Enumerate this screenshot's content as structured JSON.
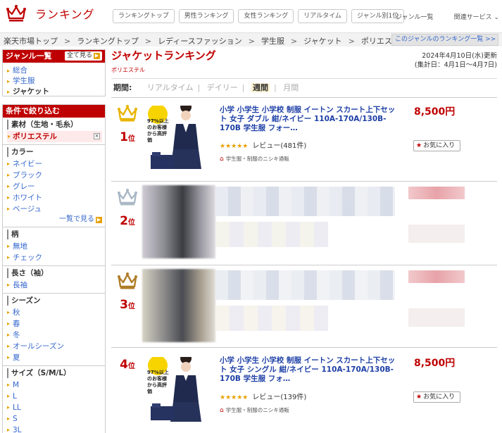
{
  "header": {
    "logo_text": "ランキング",
    "nav": [
      "ランキングトップ",
      "男性ランキング",
      "女性ランキング",
      "リアルタイム",
      "ジャンル別1位"
    ],
    "right_nav": [
      "ジャンル一覧",
      "関連サービス ⌄"
    ]
  },
  "breadcrumb": {
    "items": [
      "楽天市場トップ",
      "ランキングトップ",
      "レディースファッション",
      "学生服",
      "ジャケット",
      "ポリエステル"
    ],
    "separator": ">",
    "genre_ranking_link": "このジャンルのランキング一覧 >>"
  },
  "sidebar": {
    "genre_box": {
      "title": "ジャンル一覧",
      "all_button": "全て見る",
      "items": [
        {
          "label": "総合",
          "current": false
        },
        {
          "label": "学生服",
          "current": false
        },
        {
          "label": "ジャケット",
          "current": true
        }
      ]
    },
    "filter_box": {
      "title": "条件で絞り込む",
      "material": {
        "title": "素材（生地・毛糸）",
        "selected": "ポリエステル",
        "clear": "×"
      },
      "color": {
        "title": "カラー",
        "items": [
          "ネイビー",
          "ブラック",
          "グレー",
          "ホワイト",
          "ベージュ"
        ],
        "more": "一覧で見る"
      },
      "pattern": {
        "title": "柄",
        "items": [
          "無地",
          "チェック"
        ]
      },
      "sleeve": {
        "title": "長さ（袖）",
        "items": [
          "長袖"
        ]
      },
      "season": {
        "title": "シーズン",
        "items": [
          "秋",
          "春",
          "冬",
          "オールシーズン",
          "夏"
        ]
      },
      "size": {
        "title": "サイズ（S/M/L）",
        "items": [
          "M",
          "L",
          "LL",
          "S",
          "3L"
        ]
      }
    }
  },
  "main": {
    "title": "ジャケットランキング",
    "subtitle": "ポリエステル",
    "updated": "2024年4月10日(水)更新",
    "period_range": "(集計日：4月1日～4月7日)",
    "period": {
      "label": "期間:",
      "options": [
        {
          "label": "リアルタイム",
          "active": false
        },
        {
          "label": "デイリー",
          "active": false
        },
        {
          "label": "週間",
          "active": true
        },
        {
          "label": "月間",
          "active": false
        }
      ]
    },
    "items": [
      {
        "rank": "1",
        "rank_suffix": "位",
        "name": "小学 小学生 小学校 制服 イートン スカート上下セット 女子 ダブル 紺/ネイビー 110A-170A/130B-170B 学生服 フォー…",
        "rating": "★★★★★",
        "reviews": "レビュー(481件)",
        "shop": "学生服・制服のニシキ通販",
        "price": "8,500円",
        "fav": "お気に入り",
        "badge": "97%以上のお客様から高評価",
        "crown_color": "#e8b400"
      },
      {
        "rank": "2",
        "rank_suffix": "位",
        "crown_color": "#a9b8c6"
      },
      {
        "rank": "3",
        "rank_suffix": "位",
        "crown_color": "#b07c28"
      },
      {
        "rank": "4",
        "rank_suffix": "位",
        "name": "小学 小学生 小学校 制服 イートン スカート上下セット 女子 シングル 紺/ネイビー 110A-170A/130B-170B 学生服 フォ…",
        "rating": "★★★★★",
        "reviews": "レビュー(139件)",
        "shop": "学生服・制服のニシキ通販",
        "price": "8,500円",
        "fav": "お気に入り",
        "badge": "97%以上のお客様から高評価"
      }
    ]
  },
  "colors": {
    "brand_red": "#bf0000",
    "link_blue": "#1d3fa6",
    "star": "#e8a000"
  }
}
